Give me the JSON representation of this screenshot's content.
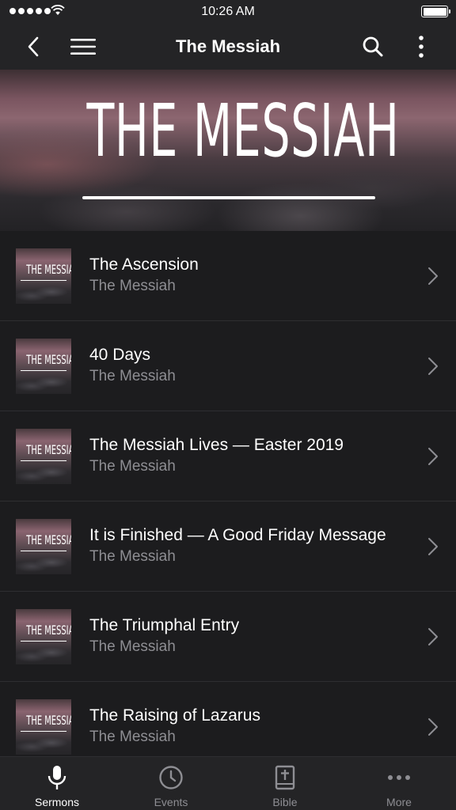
{
  "status_bar": {
    "time": "10:26 AM"
  },
  "nav": {
    "title": "The Messiah",
    "back_icon": "chevron-left-icon",
    "menu_icon": "hamburger-icon",
    "search_icon": "search-icon",
    "more_icon": "vertical-ellipsis-icon"
  },
  "hero": {
    "title": "THE MESSIAH"
  },
  "sermons": [
    {
      "title": "The Ascension",
      "series": "The Messiah",
      "thumb_text": "THE MESSIAH"
    },
    {
      "title": "40 Days",
      "series": "The Messiah",
      "thumb_text": "THE MESSIAH"
    },
    {
      "title": "The Messiah Lives — Easter 2019",
      "series": "The Messiah",
      "thumb_text": "THE MESSIAH"
    },
    {
      "title": "It is Finished — A Good Friday Message",
      "series": "The Messiah",
      "thumb_text": "THE MESSIAH"
    },
    {
      "title": "The Triumphal Entry",
      "series": "The Messiah",
      "thumb_text": "THE MESSIAH"
    },
    {
      "title": "The Raising of Lazarus",
      "series": "The Messiah",
      "thumb_text": "THE MESSIAH"
    }
  ],
  "tabs": [
    {
      "label": "Sermons",
      "icon": "microphone-icon",
      "active": true
    },
    {
      "label": "Events",
      "icon": "clock-icon",
      "active": false
    },
    {
      "label": "Bible",
      "icon": "bible-icon",
      "active": false
    },
    {
      "label": "More",
      "icon": "horizontal-ellipsis-icon",
      "active": false
    }
  ],
  "colors": {
    "background": "#1c1c1e",
    "bar": "#242426",
    "secondary_text": "#8e8e93",
    "primary_text": "#ffffff"
  }
}
